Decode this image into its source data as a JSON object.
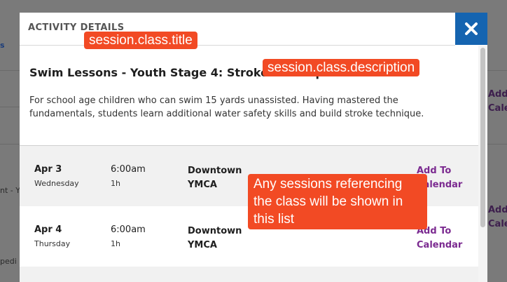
{
  "background": {
    "left_fragments": [
      "s",
      "nt - Y",
      "pedi"
    ],
    "right_links": [
      {
        "line1": "Add",
        "line2": "Cale"
      },
      {
        "line1": "Add",
        "line2": "Cale"
      }
    ]
  },
  "modal": {
    "header_title": "ACTIVITY DETAILS",
    "close_icon": "close-icon",
    "accent_color": "#1564b0",
    "class_title": "Swim Lessons - Youth Stage 4: Stroke Development",
    "class_description": "For school age children who can swim 15 yards unassisted. Having mastered the fundamentals, students learn additional water safety skills and build stroke technique.",
    "sessions": [
      {
        "date": "Apr 3",
        "day": "Wednesday",
        "time": "6:00am",
        "duration": "1h",
        "location_line1": "Downtown",
        "location_line2": "YMCA",
        "add_line1": "Add To",
        "add_line2": "Calendar"
      },
      {
        "date": "Apr 4",
        "day": "Thursday",
        "time": "6:00am",
        "duration": "1h",
        "location_line1": "Downtown",
        "location_line2": "YMCA",
        "add_line1": "Add To",
        "add_line2": "Calendar"
      }
    ]
  },
  "annotations": {
    "color": "#f24a24",
    "title_label": "session.class.title",
    "description_label": "session.class.description",
    "sessions_label_line1": "Any sessions referencing",
    "sessions_label_line2": "the class will be shown in",
    "sessions_label_line3": "this list"
  }
}
